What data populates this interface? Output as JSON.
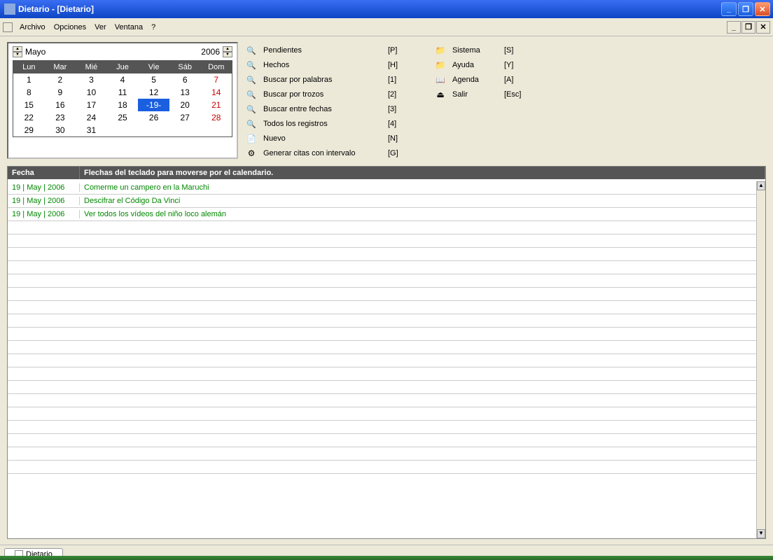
{
  "window": {
    "title": "Dietario - [Dietario]"
  },
  "menu": {
    "items": [
      "Archivo",
      "Opciones",
      "Ver",
      "Ventana",
      "?"
    ]
  },
  "calendar": {
    "month": "Mayo",
    "year": "2006",
    "headers": [
      "Lun",
      "Mar",
      "Mié",
      "Jue",
      "Vie",
      "Sáb",
      "Dom"
    ],
    "weeks": [
      [
        {
          "d": "1"
        },
        {
          "d": "2"
        },
        {
          "d": "3"
        },
        {
          "d": "4"
        },
        {
          "d": "5"
        },
        {
          "d": "6"
        },
        {
          "d": "7",
          "sun": true
        }
      ],
      [
        {
          "d": "8"
        },
        {
          "d": "9"
        },
        {
          "d": "10"
        },
        {
          "d": "11"
        },
        {
          "d": "12"
        },
        {
          "d": "13"
        },
        {
          "d": "14",
          "sun": true
        }
      ],
      [
        {
          "d": "15"
        },
        {
          "d": "16"
        },
        {
          "d": "17"
        },
        {
          "d": "18"
        },
        {
          "d": "-19-",
          "sel": true
        },
        {
          "d": "20"
        },
        {
          "d": "21",
          "sun": true
        }
      ],
      [
        {
          "d": "22"
        },
        {
          "d": "23"
        },
        {
          "d": "24"
        },
        {
          "d": "25"
        },
        {
          "d": "26"
        },
        {
          "d": "27"
        },
        {
          "d": "28",
          "sun": true
        }
      ],
      [
        {
          "d": "29"
        },
        {
          "d": "30"
        },
        {
          "d": "31"
        },
        {
          "d": ""
        },
        {
          "d": ""
        },
        {
          "d": ""
        },
        {
          "d": ""
        }
      ]
    ]
  },
  "actions_col1": [
    {
      "icon": "icon-search",
      "label": "Pendientes",
      "short": "[P]"
    },
    {
      "icon": "icon-search",
      "label": "Hechos",
      "short": "[H]"
    },
    {
      "icon": "icon-search",
      "label": "Buscar por palabras",
      "short": "[1]"
    },
    {
      "icon": "icon-search",
      "label": "Buscar por trozos",
      "short": "[2]"
    },
    {
      "icon": "icon-search",
      "label": "Buscar entre fechas",
      "short": "[3]"
    },
    {
      "icon": "icon-search",
      "label": "Todos los registros",
      "short": "[4]"
    },
    {
      "icon": "icon-new",
      "label": "Nuevo",
      "short": "[N]"
    },
    {
      "icon": "icon-gear",
      "label": "Generar citas con intervalo",
      "short": "[G]"
    }
  ],
  "actions_col2": [
    {
      "icon": "icon-folder",
      "label": "Sistema",
      "short": "[S]"
    },
    {
      "icon": "icon-folder",
      "label": "Ayuda",
      "short": "[Y]"
    },
    {
      "icon": "icon-book",
      "label": "Agenda",
      "short": "[A]"
    },
    {
      "icon": "icon-exit",
      "label": "Salir",
      "short": "[Esc]"
    }
  ],
  "table": {
    "header_date": "Fecha",
    "header_desc": "Flechas del teclado para moverse por el calendario.",
    "rows": [
      {
        "date": "19 | May | 2006",
        "desc": "Comerme un campero en la Maruchi"
      },
      {
        "date": "19 | May | 2006",
        "desc": "Descifrar el Código Da Vinci"
      },
      {
        "date": "19 | May | 2006",
        "desc": "Ver todos los vídeos del niño loco alemán"
      }
    ],
    "empty_rows": 19
  },
  "doctab": {
    "label": "Dietario"
  }
}
